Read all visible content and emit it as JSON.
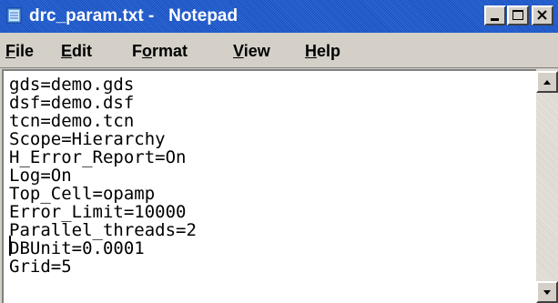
{
  "window": {
    "title": "drc_param.txt -   Notepad",
    "icon": "notepad-icon"
  },
  "caption_buttons": {
    "minimize": "minimize-icon",
    "maximize": "maximize-icon",
    "close": "close-icon"
  },
  "menu": {
    "items": [
      {
        "mnemonic": "F",
        "rest": "ile"
      },
      {
        "mnemonic": "E",
        "rest": "dit"
      },
      {
        "pre": "F",
        "mnemonic": "o",
        "rest": "rmat"
      },
      {
        "mnemonic": "V",
        "rest": "iew"
      },
      {
        "mnemonic": "H",
        "rest": "elp"
      }
    ]
  },
  "editor": {
    "lines": [
      "gds=demo.gds",
      "dsf=demo.dsf",
      "tcn=demo.tcn",
      "Scope=Hierarchy",
      "H_Error_Report=On",
      "Log=On",
      "Top_Cell=opamp",
      "Error_Limit=10000",
      "Parallel_threads=2",
      "DBUnit=0.0001",
      "Grid=5"
    ]
  },
  "colors": {
    "title_bar": "#2f6ed8",
    "chrome": "#d4d0c8",
    "editor_bg": "#ffffff"
  }
}
